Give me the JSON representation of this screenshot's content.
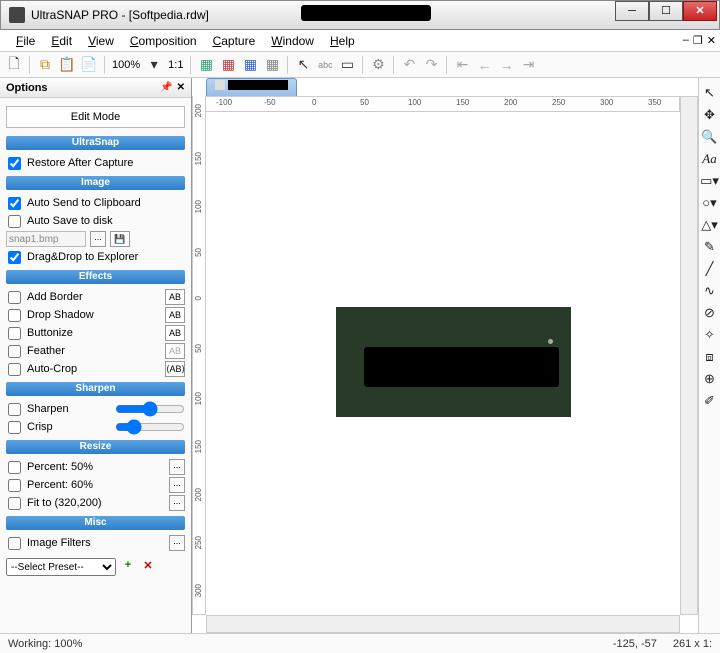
{
  "title": "UltraSNAP PRO - [Softpedia.rdw]",
  "menus": [
    "File",
    "Edit",
    "View",
    "Composition",
    "Capture",
    "Window",
    "Help"
  ],
  "zoom": "100%",
  "zoom_1to1": "1:1",
  "panel_title": "Options",
  "edit_mode": "Edit Mode",
  "groups": {
    "ultrasnap": {
      "header": "UltraSnap",
      "restore": "Restore After Capture"
    },
    "image": {
      "header": "Image",
      "autosend": "Auto Send to Clipboard",
      "autosave": "Auto Save to disk",
      "filename": "snap1.bmp",
      "dragdrop": "Drag&Drop to Explorer"
    },
    "effects": {
      "header": "Effects",
      "items": [
        "Add Border",
        "Drop Shadow",
        "Buttonize",
        "Feather",
        "Auto-Crop"
      ]
    },
    "sharpen": {
      "header": "Sharpen",
      "sharpen": "Sharpen",
      "crisp": "Crisp"
    },
    "resize": {
      "header": "Resize",
      "p1": "Percent: 50%",
      "p2": "Percent: 60%",
      "fit": "Fit to (320,200)"
    },
    "misc": {
      "header": "Misc",
      "filters": "Image Filters",
      "preset": "--Select Preset--"
    }
  },
  "ruler_h": [
    "-100",
    "-50",
    "0",
    "50",
    "100",
    "150",
    "200",
    "250",
    "300",
    "350"
  ],
  "ruler_v": [
    "200",
    "150",
    "100",
    "50",
    "0",
    "50",
    "100",
    "150",
    "200",
    "250",
    "300"
  ],
  "status": {
    "left": "Working: 100%",
    "coord": "-125, -57",
    "size": "261 x 1:"
  },
  "effect_btn": "AB",
  "effect_btn_alt": "⟨AB⟩"
}
